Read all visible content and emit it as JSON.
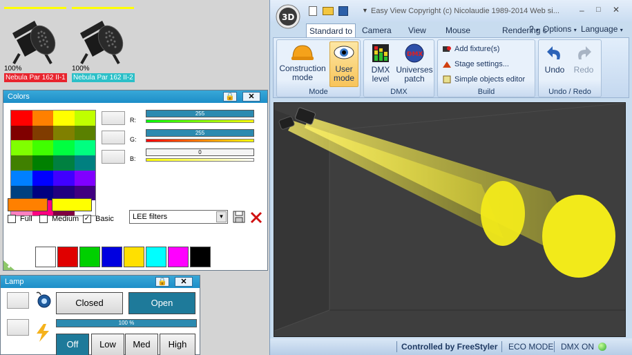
{
  "fixtures": [
    {
      "percent": "100%",
      "name": "Nebula Par 162 II-1",
      "name_color": "#e8242e"
    },
    {
      "percent": "100%",
      "name": "Nebula Par 162 II-2",
      "name_color": "#2cc0c8"
    }
  ],
  "colors_panel": {
    "title": "Colors",
    "swatches": [
      "#ff0000",
      "#ff8000",
      "#ffff00",
      "#c0ff00",
      "#800000",
      "#803c00",
      "#808000",
      "#5a8000",
      "#80ff00",
      "#40ff00",
      "#00ff40",
      "#00ff80",
      "#408000",
      "#008000",
      "#008040",
      "#008080",
      "#0080ff",
      "#0000ff",
      "#4000ff",
      "#8000ff",
      "#004080",
      "#000080",
      "#200080",
      "#400080",
      "#ff80c0",
      "#ff0080",
      "#800040",
      "#ffffff"
    ],
    "r_label": "R:",
    "g_label": "G:",
    "b_label": "B:",
    "r_value": "255",
    "g_value": "255",
    "b_value": "0",
    "current_color_a": "#ff8000",
    "current_color_b": "#ffff00",
    "options": {
      "full": "Full",
      "medium": "Medium",
      "basic": "Basic"
    },
    "filter_select": "LEE filters",
    "basic_colors": [
      "#ffffff",
      "#e00000",
      "#00d000",
      "#0000e0",
      "#ffe000",
      "#00ffff",
      "#ff00ff",
      "#000000"
    ]
  },
  "lamp_panel": {
    "title": "Lamp",
    "closed": "Closed",
    "open": "Open",
    "dimmer_value": "100 %",
    "off": "Off",
    "low": "Low",
    "med": "Med",
    "high": "High"
  },
  "window": {
    "title": "Easy View   Copyright (c) Nicolaudie 1989-2014   Web si...",
    "tabs": [
      "Standard to",
      "Camera",
      "View",
      "Mouse",
      "Rendering c"
    ],
    "right_menu": [
      "?",
      "Options",
      "Language"
    ],
    "groups": {
      "mode": "Mode",
      "dmx": "DMX",
      "build": "Build",
      "undo_redo": "Undo / Redo"
    },
    "buttons": {
      "construction": "Construction mode",
      "user": "User mode",
      "dmx_level": "DMX level",
      "universes": "Universes patch",
      "add_fixture": "Add fixture(s)",
      "stage_settings": "Stage settings...",
      "simple_objects": "Simple objects editor",
      "undo": "Undo",
      "redo": "Redo"
    },
    "status": {
      "controlled": "Controlled by FreeStyler",
      "eco": "ECO MODE",
      "dmx": "DMX ON"
    },
    "colors": {
      "beam": "#f2ea1a",
      "accent": "#1d8ec8"
    }
  }
}
